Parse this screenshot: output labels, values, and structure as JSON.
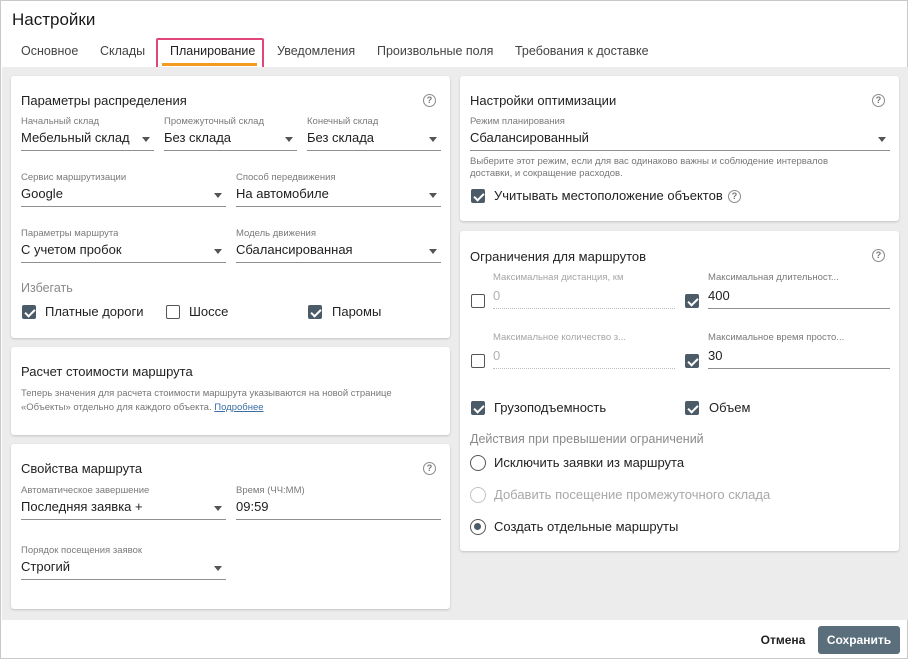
{
  "window": {
    "title": "Настройки"
  },
  "tabs": [
    {
      "label": "Основное"
    },
    {
      "label": "Склады"
    },
    {
      "label": "Планирование"
    },
    {
      "label": "Уведомления"
    },
    {
      "label": "Произвольные поля"
    },
    {
      "label": "Требования к доставке"
    }
  ],
  "active_tab": "Планирование",
  "distribution": {
    "title": "Параметры распределения",
    "start_warehouse": {
      "label": "Начальный склад",
      "value": "Мебельный склад"
    },
    "intermediate_warehouse": {
      "label": "Промежуточный склад",
      "value": "Без склада"
    },
    "end_warehouse": {
      "label": "Конечный склад",
      "value": "Без склада"
    },
    "routing_service": {
      "label": "Сервис маршрутизации",
      "value": "Google"
    },
    "transport_mode": {
      "label": "Способ передвижения",
      "value": "На автомобиле"
    },
    "route_params": {
      "label": "Параметры маршрута",
      "value": "С учетом пробок"
    },
    "movement_model": {
      "label": "Модель движения",
      "value": "Сбалансированная"
    },
    "avoid": {
      "title": "Избегать",
      "toll_roads": {
        "label": "Платные дороги",
        "checked": true
      },
      "highways": {
        "label": "Шоссе",
        "checked": false
      },
      "ferries": {
        "label": "Паромы",
        "checked": true
      }
    }
  },
  "cost": {
    "title": "Расчет стоимости маршрута",
    "text": "Теперь значения для расчета стоимости маршрута указываются на новой странице «Объекты» отдельно для каждого объекта.",
    "link": "Подробнее"
  },
  "route_props": {
    "title": "Свойства маршрута",
    "auto_complete": {
      "label": "Автоматическое завершение",
      "value": "Последняя заявка +"
    },
    "time": {
      "label": "Время (ЧЧ:ММ)",
      "value": "09:59"
    },
    "visit_order": {
      "label": "Порядок посещения заявок",
      "value": "Строгий"
    }
  },
  "optimization": {
    "title": "Настройки оптимизации",
    "mode": {
      "label": "Режим планирования",
      "value": "Сбалансированный"
    },
    "hint": "Выберите этот режим, если для вас одинаково важны и соблюдение интервалов доставки, и сокращение расходов.",
    "consider_location": {
      "label": "Учитывать местоположение объектов",
      "checked": true
    }
  },
  "limits": {
    "title": "Ограничения для маршрутов",
    "max_distance": {
      "label": "Максимальная дистанция, км",
      "value": "0",
      "checked": false
    },
    "max_duration": {
      "label": "Максимальная длительност...",
      "value": "400",
      "checked": true
    },
    "max_count": {
      "label": "Максимальное количество з...",
      "value": "0",
      "checked": false
    },
    "max_idle": {
      "label": "Максимальное время просто...",
      "value": "30",
      "checked": true
    },
    "capacity": {
      "label": "Грузоподъемность",
      "checked": true
    },
    "volume": {
      "label": "Объем",
      "checked": true
    },
    "actions_title": "Действия при превышении ограничений",
    "actions": [
      {
        "label": "Исключить заявки из маршрута",
        "selected": false,
        "disabled": false
      },
      {
        "label": "Добавить посещение промежуточного склада",
        "selected": false,
        "disabled": true
      },
      {
        "label": "Создать отдельные маршруты",
        "selected": true,
        "disabled": false
      }
    ]
  },
  "footer": {
    "cancel_label": "Отмена",
    "save_label": "Сохранить"
  },
  "colors": {
    "accent_underline": "#f39b1f",
    "highlight_border": "#e0457b",
    "checkbox": "#4b5b68",
    "save_button": "#5a6e7b"
  }
}
